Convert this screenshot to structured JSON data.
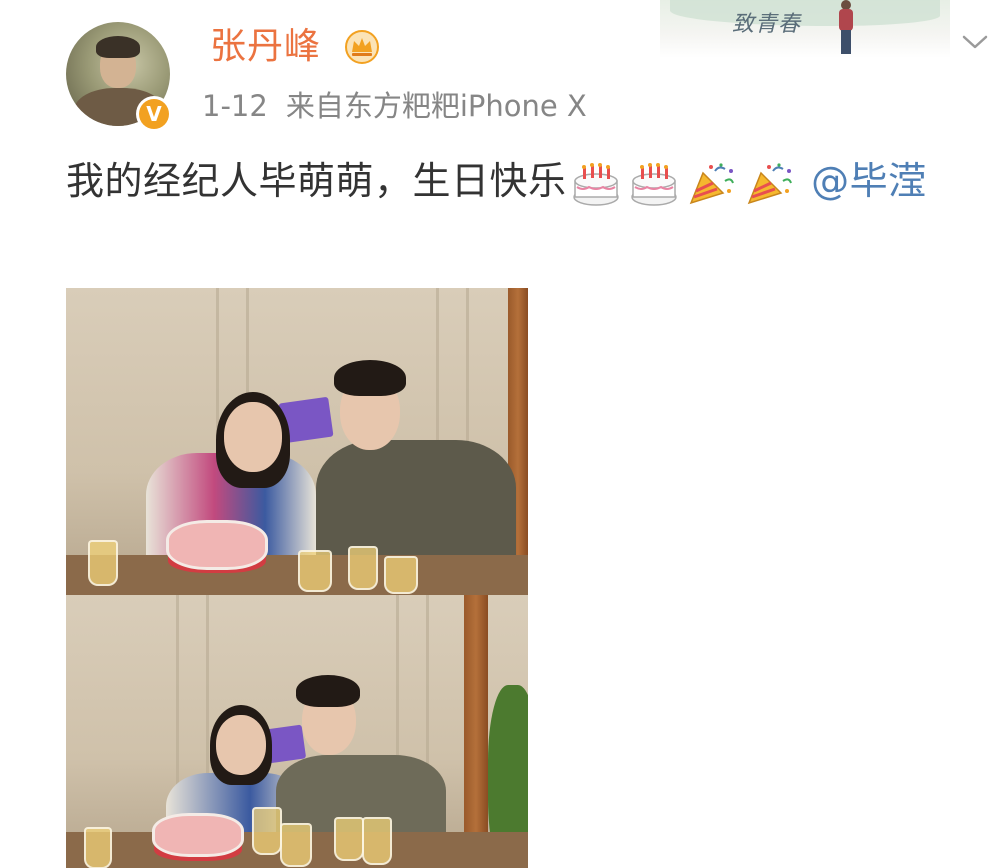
{
  "header": {
    "banner_text": "致青春"
  },
  "user": {
    "name": "张丹峰",
    "verified_mark": "V",
    "avatar": "user-avatar",
    "crown_icon": "crown-icon"
  },
  "post": {
    "date": "1-12",
    "source": "来自东方粑粑iPhone X",
    "text": "我的经纪人毕萌萌，生日快乐",
    "emojis": [
      "birthday-cake",
      "birthday-cake",
      "party-popper",
      "party-popper"
    ],
    "mention": "@毕滢"
  },
  "photos": [
    {
      "name": "photo-1"
    },
    {
      "name": "photo-2"
    }
  ],
  "colors": {
    "username": "#eb7340",
    "mention": "#4f7fb5",
    "meta": "#868686",
    "body_text": "#333333",
    "verified": "#f2a121"
  }
}
